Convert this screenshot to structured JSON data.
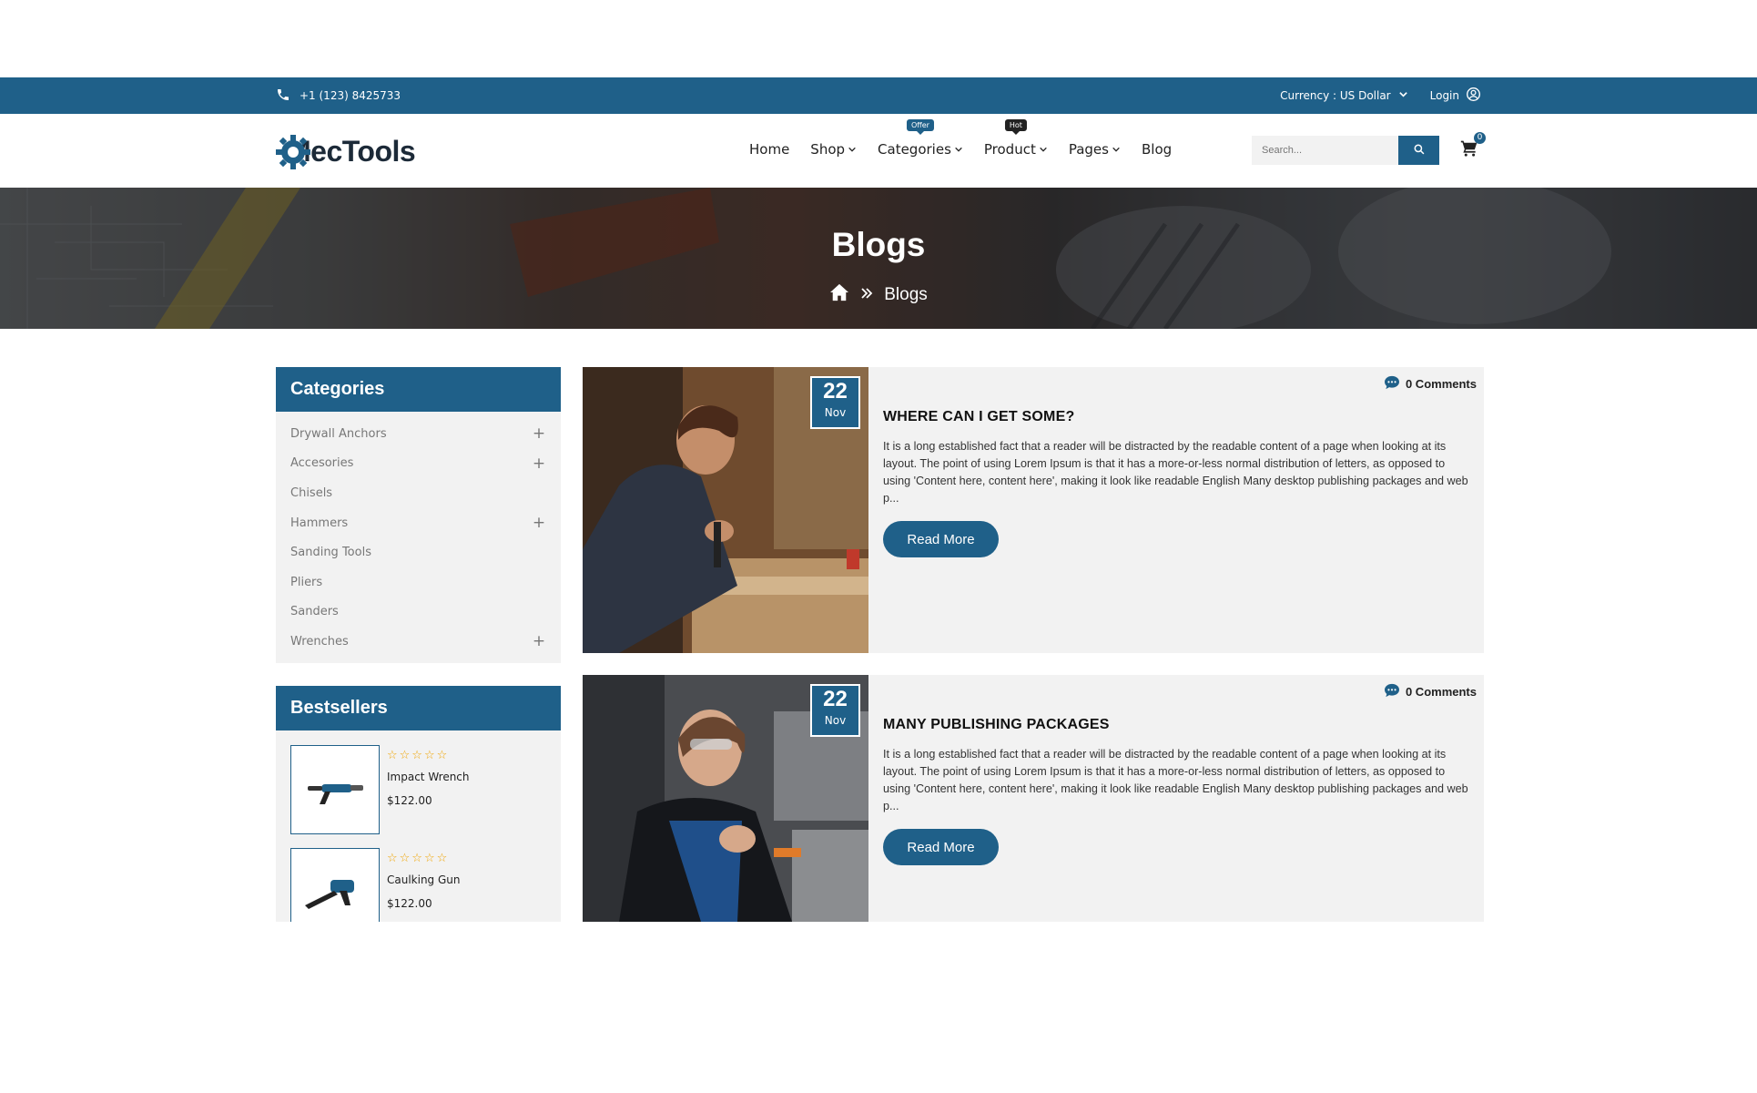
{
  "topbar": {
    "phone": "+1 (123) 8425733",
    "currency_label": "Currency : US Dollar",
    "login_label": "Login"
  },
  "header": {
    "logo_text": "MecTools",
    "nav": [
      {
        "label": "Home",
        "has_dropdown": false,
        "badge": ""
      },
      {
        "label": "Shop",
        "has_dropdown": true,
        "badge": ""
      },
      {
        "label": "Categories",
        "has_dropdown": true,
        "badge": "Offer"
      },
      {
        "label": "Product",
        "has_dropdown": true,
        "badge": "Hot"
      },
      {
        "label": "Pages",
        "has_dropdown": true,
        "badge": ""
      },
      {
        "label": "Blog",
        "has_dropdown": false,
        "badge": ""
      }
    ],
    "search_placeholder": "Search...",
    "cart_count": "0"
  },
  "banner": {
    "title": "Blogs",
    "breadcrumb_current": "Blogs"
  },
  "sidebar": {
    "categories_title": "Categories",
    "categories": [
      {
        "label": "Drywall Anchors",
        "expandable": true
      },
      {
        "label": "Accesories",
        "expandable": true
      },
      {
        "label": "Chisels",
        "expandable": false
      },
      {
        "label": "Hammers",
        "expandable": true
      },
      {
        "label": "Sanding Tools",
        "expandable": false
      },
      {
        "label": "Pliers",
        "expandable": false
      },
      {
        "label": "Sanders",
        "expandable": false
      },
      {
        "label": "Wrenches",
        "expandable": true
      }
    ],
    "bestsellers_title": "Bestsellers",
    "bestsellers": [
      {
        "name": "Impact Wrench",
        "price": "$122.00",
        "rating": 0
      },
      {
        "name": "Caulking Gun",
        "price": "$122.00",
        "rating": 0
      }
    ]
  },
  "posts": [
    {
      "day": "22",
      "month": "Nov",
      "comments": "0 Comments",
      "title": "WHERE CAN I GET SOME?",
      "excerpt": "It is a long established fact that a reader will be distracted by the readable content of a page when looking at its layout. The point of using Lorem Ipsum is that it has a more-or-less normal distribution of letters, as opposed to using 'Content here, content here', making it look like readable English Many desktop publishing packages and web p...",
      "button": "Read More"
    },
    {
      "day": "22",
      "month": "Nov",
      "comments": "0 Comments",
      "title": "MANY PUBLISHING PACKAGES",
      "excerpt": "It is a long established fact that a reader will be distracted by the readable content of a page when looking at its layout. The point of using Lorem Ipsum is that it has a more-or-less normal distribution of letters, as opposed to using 'Content here, content here', making it look like readable English Many desktop publishing packages and web p...",
      "button": "Read More"
    }
  ],
  "colors": {
    "primary": "#1f6089",
    "panel": "#f2f2f2",
    "star": "#f0a400"
  }
}
